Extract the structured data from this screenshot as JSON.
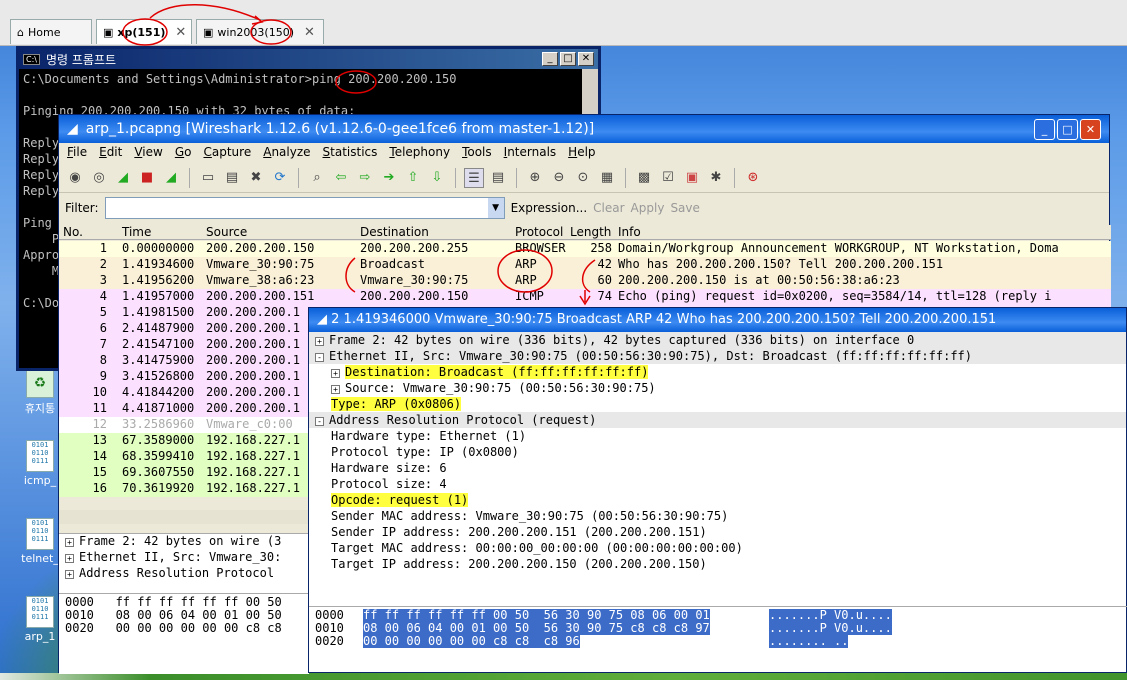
{
  "vm_tabs": [
    {
      "label": "Home",
      "icon": "home-icon"
    },
    {
      "label": "xp(151)",
      "icon": "vm-icon"
    },
    {
      "label": "win2003(150)",
      "icon": "vm-icon"
    }
  ],
  "cmd": {
    "title": "명령 프롬프트",
    "lines": [
      "C:\\Documents and Settings\\Administrator>ping 200.200.200.150",
      "",
      "Pinging 200.200.200.150 with 32 bytes of data:",
      "",
      "Reply",
      "Reply",
      "Reply",
      "Reply",
      "",
      "Ping",
      "    P",
      "Appro",
      "    M",
      "",
      "C:\\Do"
    ]
  },
  "desktop_icons": [
    "휴지통",
    "icmp_",
    "telnet_",
    "arp_1"
  ],
  "wireshark": {
    "title": "arp_1.pcapng   [Wireshark 1.12.6  (v1.12.6-0-gee1fce6 from master-1.12)]",
    "menu": [
      "File",
      "Edit",
      "View",
      "Go",
      "Capture",
      "Analyze",
      "Statistics",
      "Telephony",
      "Tools",
      "Internals",
      "Help"
    ],
    "filter_label": "Filter:",
    "filter_value": "",
    "filter_actions": [
      "Expression...",
      "Clear",
      "Apply",
      "Save"
    ],
    "columns": [
      "No.",
      "Time",
      "Source",
      "Destination",
      "Protocol",
      "Length",
      "Info"
    ],
    "packets": [
      {
        "no": "1",
        "time": "0.00000000",
        "src": "200.200.200.150",
        "dst": "200.200.200.255",
        "proto": "BROWSER",
        "len": "258",
        "info": "Domain/Workgroup Announcement WORKGROUP, NT Workstation, Doma",
        "color": "#ffffe0"
      },
      {
        "no": "2",
        "time": "1.41934600",
        "src": "Vmware_30:90:75",
        "dst": "Broadcast",
        "proto": "ARP",
        "len": "42",
        "info": "Who has 200.200.200.150?  Tell 200.200.200.151",
        "color": "#faf0d7"
      },
      {
        "no": "3",
        "time": "1.41956200",
        "src": "Vmware_38:a6:23",
        "dst": "Vmware_30:90:75",
        "proto": "ARP",
        "len": "60",
        "info": "200.200.200.150 is at 00:50:56:38:a6:23",
        "color": "#faf0d7"
      },
      {
        "no": "4",
        "time": "1.41957000",
        "src": "200.200.200.151",
        "dst": "200.200.200.150",
        "proto": "ICMP",
        "len": "74",
        "info": "Echo (ping) request  id=0x0200, seq=3584/14, ttl=128 (reply i",
        "color": "#fce0ff"
      },
      {
        "no": "5",
        "time": "1.41981500",
        "src": "200.200.200.1",
        "dst": "",
        "proto": "",
        "len": "",
        "info": "",
        "color": "#fce0ff"
      },
      {
        "no": "6",
        "time": "2.41487900",
        "src": "200.200.200.1",
        "dst": "",
        "proto": "",
        "len": "",
        "info": "",
        "color": "#fce0ff"
      },
      {
        "no": "7",
        "time": "2.41547100",
        "src": "200.200.200.1",
        "dst": "",
        "proto": "",
        "len": "",
        "info": "",
        "color": "#fce0ff"
      },
      {
        "no": "8",
        "time": "3.41475900",
        "src": "200.200.200.1",
        "dst": "",
        "proto": "",
        "len": "",
        "info": "",
        "color": "#fce0ff"
      },
      {
        "no": "9",
        "time": "3.41526800",
        "src": "200.200.200.1",
        "dst": "",
        "proto": "",
        "len": "",
        "info": "",
        "color": "#fce0ff"
      },
      {
        "no": "10",
        "time": "4.41844200",
        "src": "200.200.200.1",
        "dst": "",
        "proto": "",
        "len": "",
        "info": "",
        "color": "#fce0ff"
      },
      {
        "no": "11",
        "time": "4.41871000",
        "src": "200.200.200.1",
        "dst": "",
        "proto": "",
        "len": "",
        "info": "",
        "color": "#fce0ff"
      },
      {
        "no": "12",
        "time": "33.2586960",
        "src": "Vmware_c0:00",
        "dst": "",
        "proto": "",
        "len": "",
        "info": "",
        "color": "#ffffff",
        "dim": true
      },
      {
        "no": "13",
        "time": "67.3589000",
        "src": "192.168.227.1",
        "dst": "",
        "proto": "",
        "len": "",
        "info": "",
        "color": "#e0ffc0"
      },
      {
        "no": "14",
        "time": "68.3599410",
        "src": "192.168.227.1",
        "dst": "",
        "proto": "",
        "len": "",
        "info": "",
        "color": "#e0ffc0"
      },
      {
        "no": "15",
        "time": "69.3607550",
        "src": "192.168.227.1",
        "dst": "",
        "proto": "",
        "len": "",
        "info": "",
        "color": "#e0ffc0"
      },
      {
        "no": "16",
        "time": "70.3619920",
        "src": "192.168.227.1",
        "dst": "",
        "proto": "",
        "len": "",
        "info": "",
        "color": "#e0ffc0"
      }
    ],
    "detail_left": [
      "Frame 2: 42 bytes on wire (3",
      "Ethernet II, Src: Vmware_30:",
      "Address Resolution Protocol "
    ],
    "hex_left": [
      "0000   ff ff ff ff ff ff 00 50",
      "0010   08 00 06 04 00 01 00 50",
      "0020   00 00 00 00 00 00 c8 c8"
    ]
  },
  "popup": {
    "title": "2 1.419346000 Vmware_30:90:75 Broadcast ARP 42 Who has 200.200.200.150?  Tell 200.200.200.151",
    "tree": [
      {
        "indent": 0,
        "toggle": "+",
        "text": "Frame 2: 42 bytes on wire (336 bits), 42 bytes captured (336 bits) on interface 0",
        "style": "sec"
      },
      {
        "indent": 0,
        "toggle": "-",
        "text": "Ethernet II, Src: Vmware_30:90:75 (00:50:56:30:90:75), Dst: Broadcast (ff:ff:ff:ff:ff:ff)",
        "style": "sec"
      },
      {
        "indent": 1,
        "toggle": "+",
        "text": "Destination: Broadcast (ff:ff:ff:ff:ff:ff)",
        "style": "hl"
      },
      {
        "indent": 1,
        "toggle": "+",
        "text": "Source: Vmware_30:90:75 (00:50:56:30:90:75)",
        "style": ""
      },
      {
        "indent": 1,
        "toggle": "",
        "text": "Type: ARP (0x0806)",
        "style": "hl"
      },
      {
        "indent": 0,
        "toggle": "-",
        "text": "Address Resolution Protocol (request)",
        "style": "sec"
      },
      {
        "indent": 1,
        "toggle": "",
        "text": "Hardware type: Ethernet (1)",
        "style": ""
      },
      {
        "indent": 1,
        "toggle": "",
        "text": "Protocol type: IP (0x0800)",
        "style": ""
      },
      {
        "indent": 1,
        "toggle": "",
        "text": "Hardware size: 6",
        "style": ""
      },
      {
        "indent": 1,
        "toggle": "",
        "text": "Protocol size: 4",
        "style": ""
      },
      {
        "indent": 1,
        "toggle": "",
        "text": "Opcode: request (1)",
        "style": "hl"
      },
      {
        "indent": 1,
        "toggle": "",
        "text": "Sender MAC address: Vmware_30:90:75 (00:50:56:30:90:75)",
        "style": ""
      },
      {
        "indent": 1,
        "toggle": "",
        "text": "Sender IP address: 200.200.200.151 (200.200.200.151)",
        "style": ""
      },
      {
        "indent": 1,
        "toggle": "",
        "text": "Target MAC address: 00:00:00_00:00:00 (00:00:00:00:00:00)",
        "style": ""
      },
      {
        "indent": 1,
        "toggle": "",
        "text": "Target IP address: 200.200.200.150 (200.200.200.150)",
        "style": ""
      }
    ],
    "hex": [
      {
        "off": "0000",
        "bytes": "ff ff ff ff ff ff 00 50  56 30 90 75 08 06 00 01",
        "ascii": ".......P V0.u...."
      },
      {
        "off": "0010",
        "bytes": "08 00 06 04 00 01 00 50  56 30 90 75 c8 c8 c8 97",
        "ascii": ".......P V0.u...."
      },
      {
        "off": "0020",
        "bytes": "00 00 00 00 00 00 c8 c8  c8 96",
        "ascii": "........ .."
      }
    ]
  },
  "colors": {
    "highlight": "#ffff40",
    "annotation": "#e00000",
    "selection": "#3d6cc8"
  }
}
